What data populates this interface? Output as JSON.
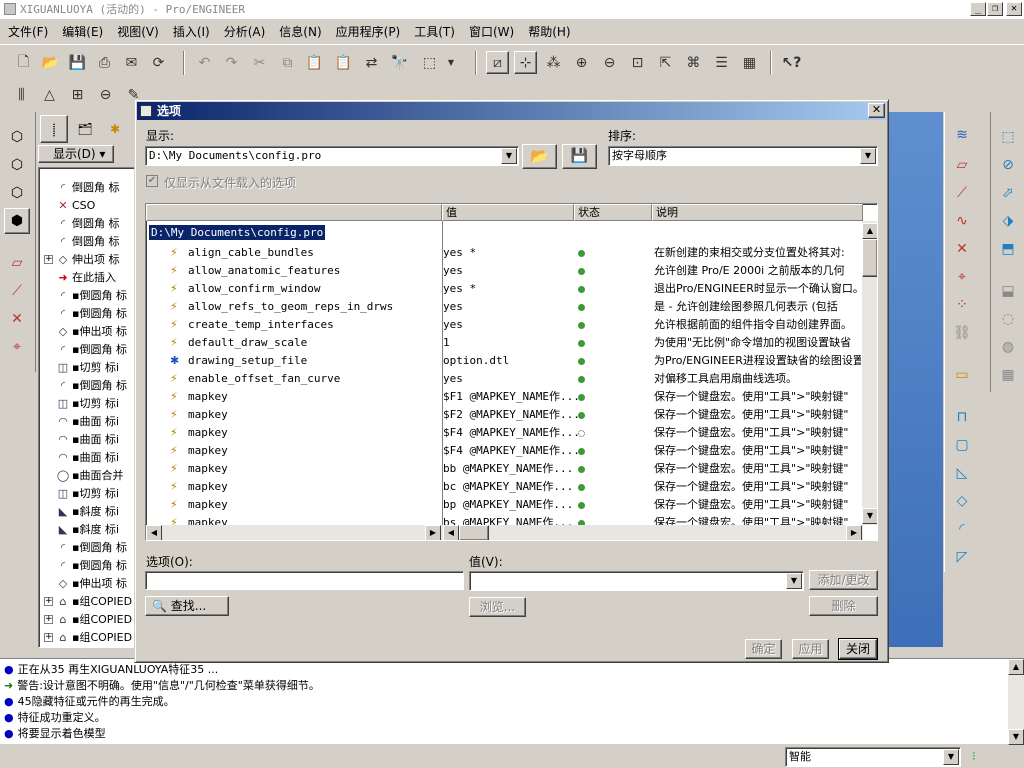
{
  "window": {
    "title": "XIGUANLUOYA (活动的) - Pro/ENGINEER"
  },
  "menu": [
    "文件(F)",
    "编辑(E)",
    "视图(V)",
    "插入(I)",
    "分析(A)",
    "信息(N)",
    "应用程序(P)",
    "工具(T)",
    "窗口(W)",
    "帮助(H)"
  ],
  "model_tree": {
    "display_label": "显示(D)",
    "items": [
      {
        "icon": "round-icon",
        "label": "倒圆角 标"
      },
      {
        "icon": "csys-icon",
        "label": "CSO"
      },
      {
        "icon": "round-icon",
        "label": "倒圆角 标"
      },
      {
        "icon": "round-icon",
        "label": "倒圆角 标"
      },
      {
        "icon": "extrude-icon",
        "label": "伸出项 标"
      },
      {
        "icon": "insert-here-icon",
        "label": "在此插入"
      },
      {
        "icon": "round-icon",
        "label": "▪倒圆角 标"
      },
      {
        "icon": "round-icon",
        "label": "▪倒圆角 标"
      },
      {
        "icon": "extrude-icon",
        "label": "▪伸出项 标"
      },
      {
        "icon": "round-icon",
        "label": "▪倒圆角 标"
      },
      {
        "icon": "cut-icon",
        "label": "▪切剪 标i"
      },
      {
        "icon": "round-icon",
        "label": "▪倒圆角 标"
      },
      {
        "icon": "cut-icon",
        "label": "▪切剪 标i"
      },
      {
        "icon": "surface-icon",
        "label": "▪曲面 标i"
      },
      {
        "icon": "surface-icon",
        "label": "▪曲面 标i"
      },
      {
        "icon": "surface-icon",
        "label": "▪曲面 标i"
      },
      {
        "icon": "merge-icon",
        "label": "▪曲面合并"
      },
      {
        "icon": "cut-icon",
        "label": "▪切剪 标i"
      },
      {
        "icon": "draft-icon",
        "label": "▪斜度 标i"
      },
      {
        "icon": "draft-icon",
        "label": "▪斜度 标i"
      },
      {
        "icon": "round-icon",
        "label": "▪倒圆角 标"
      },
      {
        "icon": "round-icon",
        "label": "▪倒圆角 标"
      },
      {
        "icon": "extrude-icon",
        "label": "▪伸出项 标"
      },
      {
        "icon": "group-icon",
        "label": "▪组COPIED"
      },
      {
        "icon": "group-icon",
        "label": "▪组COPIED"
      },
      {
        "icon": "group-icon",
        "label": "▪组COPIED"
      }
    ]
  },
  "messages": [
    {
      "bullet": "●",
      "text": "正在从35 再生XIGUANLUOYA特征35 ..."
    },
    {
      "bullet": "➜",
      "text": "警告:设计意图不明确。使用\"信息\"/\"几何检查\"菜单获得细节。"
    },
    {
      "bullet": "●",
      "text": "45隐藏特征或元件的再生完成。"
    },
    {
      "bullet": "●",
      "text": "特征成功重定义。"
    },
    {
      "bullet": "●",
      "text": "将要显示着色模型"
    }
  ],
  "status": {
    "filter_value": "智能"
  },
  "dialog": {
    "title": "选项",
    "display_label": "显示:",
    "display_value": "D:\\My Documents\\config.pro",
    "sort_label": "排序:",
    "sort_value": "按字母顺序",
    "only_loaded_label": "仅显示从文件载入的选项",
    "columns": {
      "value": "值",
      "status": "状态",
      "desc": "说明"
    },
    "root": "D:\\My Documents\\config.pro",
    "rows": [
      {
        "name": "align_cable_bundles",
        "value": "yes *",
        "desc": "在新创建的束相交或分支位置处将其对:"
      },
      {
        "name": "allow_anatomic_features",
        "value": "yes",
        "desc": "允许创建 Pro/E 2000i 之前版本的几何"
      },
      {
        "name": "allow_confirm_window",
        "value": "yes *",
        "desc": "退出Pro/ENGINEER时显示一个确认窗口。"
      },
      {
        "name": "allow_refs_to_geom_reps_in_drws",
        "value": "yes",
        "desc": "是 - 允许创建绘图参照几何表示 (包括"
      },
      {
        "name": "create_temp_interfaces",
        "value": "yes",
        "desc": "允许根据前面的组件指令自动创建界面。"
      },
      {
        "name": "default_draw_scale",
        "value": "1",
        "desc": "为使用\"无比例\"命令增加的视图设置缺省"
      },
      {
        "name": "drawing_setup_file",
        "value": "option.dtl",
        "desc": "为Pro/ENGINEER进程设置缺省的绘图设置"
      },
      {
        "name": "enable_offset_fan_curve",
        "value": "yes",
        "desc": "对偏移工具启用扇曲线选项。"
      },
      {
        "name": "mapkey",
        "value": "$F1 @MAPKEY_NAME作...",
        "desc": "保存一个键盘宏。使用\"工具\">\"映射键\""
      },
      {
        "name": "mapkey",
        "value": "$F2 @MAPKEY_NAME作...",
        "desc": "保存一个键盘宏。使用\"工具\">\"映射键\""
      },
      {
        "name": "mapkey",
        "value": "$F4 @MAPKEY_NAME作...",
        "desc": "保存一个键盘宏。使用\"工具\">\"映射键\""
      },
      {
        "name": "mapkey",
        "value": "$F4 @MAPKEY_NAME作...",
        "desc": "保存一个键盘宏。使用\"工具\">\"映射键\""
      },
      {
        "name": "mapkey",
        "value": "bb @MAPKEY_NAME作...",
        "desc": "保存一个键盘宏。使用\"工具\">\"映射键\""
      },
      {
        "name": "mapkey",
        "value": "bc @MAPKEY_NAME作...",
        "desc": "保存一个键盘宏。使用\"工具\">\"映射键\""
      },
      {
        "name": "mapkey",
        "value": "bp @MAPKEY_NAME作...",
        "desc": "保存一个键盘宏。使用\"工具\">\"映射键\""
      },
      {
        "name": "mapkey",
        "value": "bs @MAPKEY_NAME作...",
        "desc": "保存一个键盘宏。使用\"工具\">\"映射键\""
      }
    ],
    "option_label": "选项(O):",
    "value_label": "值(V):",
    "add_change": "添加/更改",
    "find": "查找...",
    "browse": "浏览...",
    "delete": "删除",
    "ok": "确定",
    "apply": "应用",
    "close": "关闭"
  }
}
